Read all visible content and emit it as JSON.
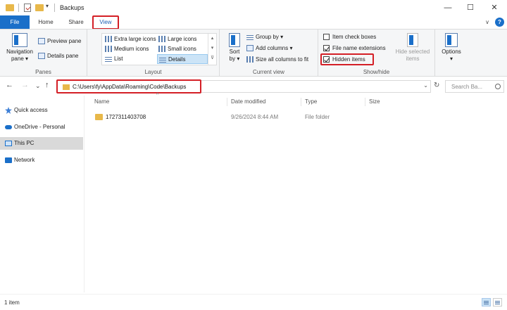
{
  "window": {
    "title": "Backups",
    "quick_access_caret": "▾",
    "minimize": "—",
    "maximize": "☐",
    "close": "✕"
  },
  "tabs": {
    "file": "File",
    "home": "Home",
    "share": "Share",
    "view": "View",
    "collapse": "∨",
    "help": "?"
  },
  "ribbon": {
    "panes": {
      "label": "Panes",
      "navigation_pane": "Navigation",
      "navigation_pane_2": "pane ▾",
      "preview_pane": "Preview pane",
      "details_pane": "Details pane"
    },
    "layout": {
      "label": "Layout",
      "items": [
        "Extra large icons",
        "Large icons",
        "Medium icons",
        "Small icons",
        "List",
        "Details"
      ],
      "selected": "Details",
      "scroll_up": "▴",
      "scroll_down": "▾",
      "more": "⊽"
    },
    "current_view": {
      "label": "Current view",
      "sort_by": "Sort",
      "sort_by_2": "by ▾",
      "group_by": "Group by ▾",
      "add_columns": "Add columns ▾",
      "size_all_columns": "Size all columns to fit"
    },
    "show_hide": {
      "label": "Show/hide",
      "item_check_boxes": "Item check boxes",
      "item_check_boxes_checked": false,
      "file_name_extensions": "File name extensions",
      "file_name_extensions_checked": true,
      "hidden_items": "Hidden items",
      "hidden_items_checked": true,
      "hide_selected": "Hide selected",
      "hide_selected_2": "items"
    },
    "options": {
      "label": "Options",
      "caret": "▾"
    }
  },
  "address_bar": {
    "back": "←",
    "forward": "→",
    "recent": "⌄",
    "up": "↑",
    "path": "C:\\Users\\fy\\AppData\\Roaming\\Code\\Backups",
    "dropdown": "⌄",
    "refresh": "↻",
    "search_placeholder": "Search Ba..."
  },
  "navigation_pane": {
    "items": [
      "Quick access",
      "OneDrive - Personal",
      "This PC",
      "Network"
    ],
    "selected": "This PC"
  },
  "columns": {
    "sort_caret": "^",
    "name": "Name",
    "date_modified": "Date modified",
    "type": "Type",
    "size": "Size"
  },
  "files": [
    {
      "name": "1727311403708",
      "date_modified": "9/26/2024 8:44 AM",
      "type": "File folder",
      "size": ""
    }
  ],
  "status_bar": {
    "item_count": "1 item"
  },
  "colors": {
    "accent_blue": "#1a6fc9",
    "highlight_red": "#d41f26",
    "folder_yellow": "#e8b84a",
    "selection": "#cce4f7"
  }
}
